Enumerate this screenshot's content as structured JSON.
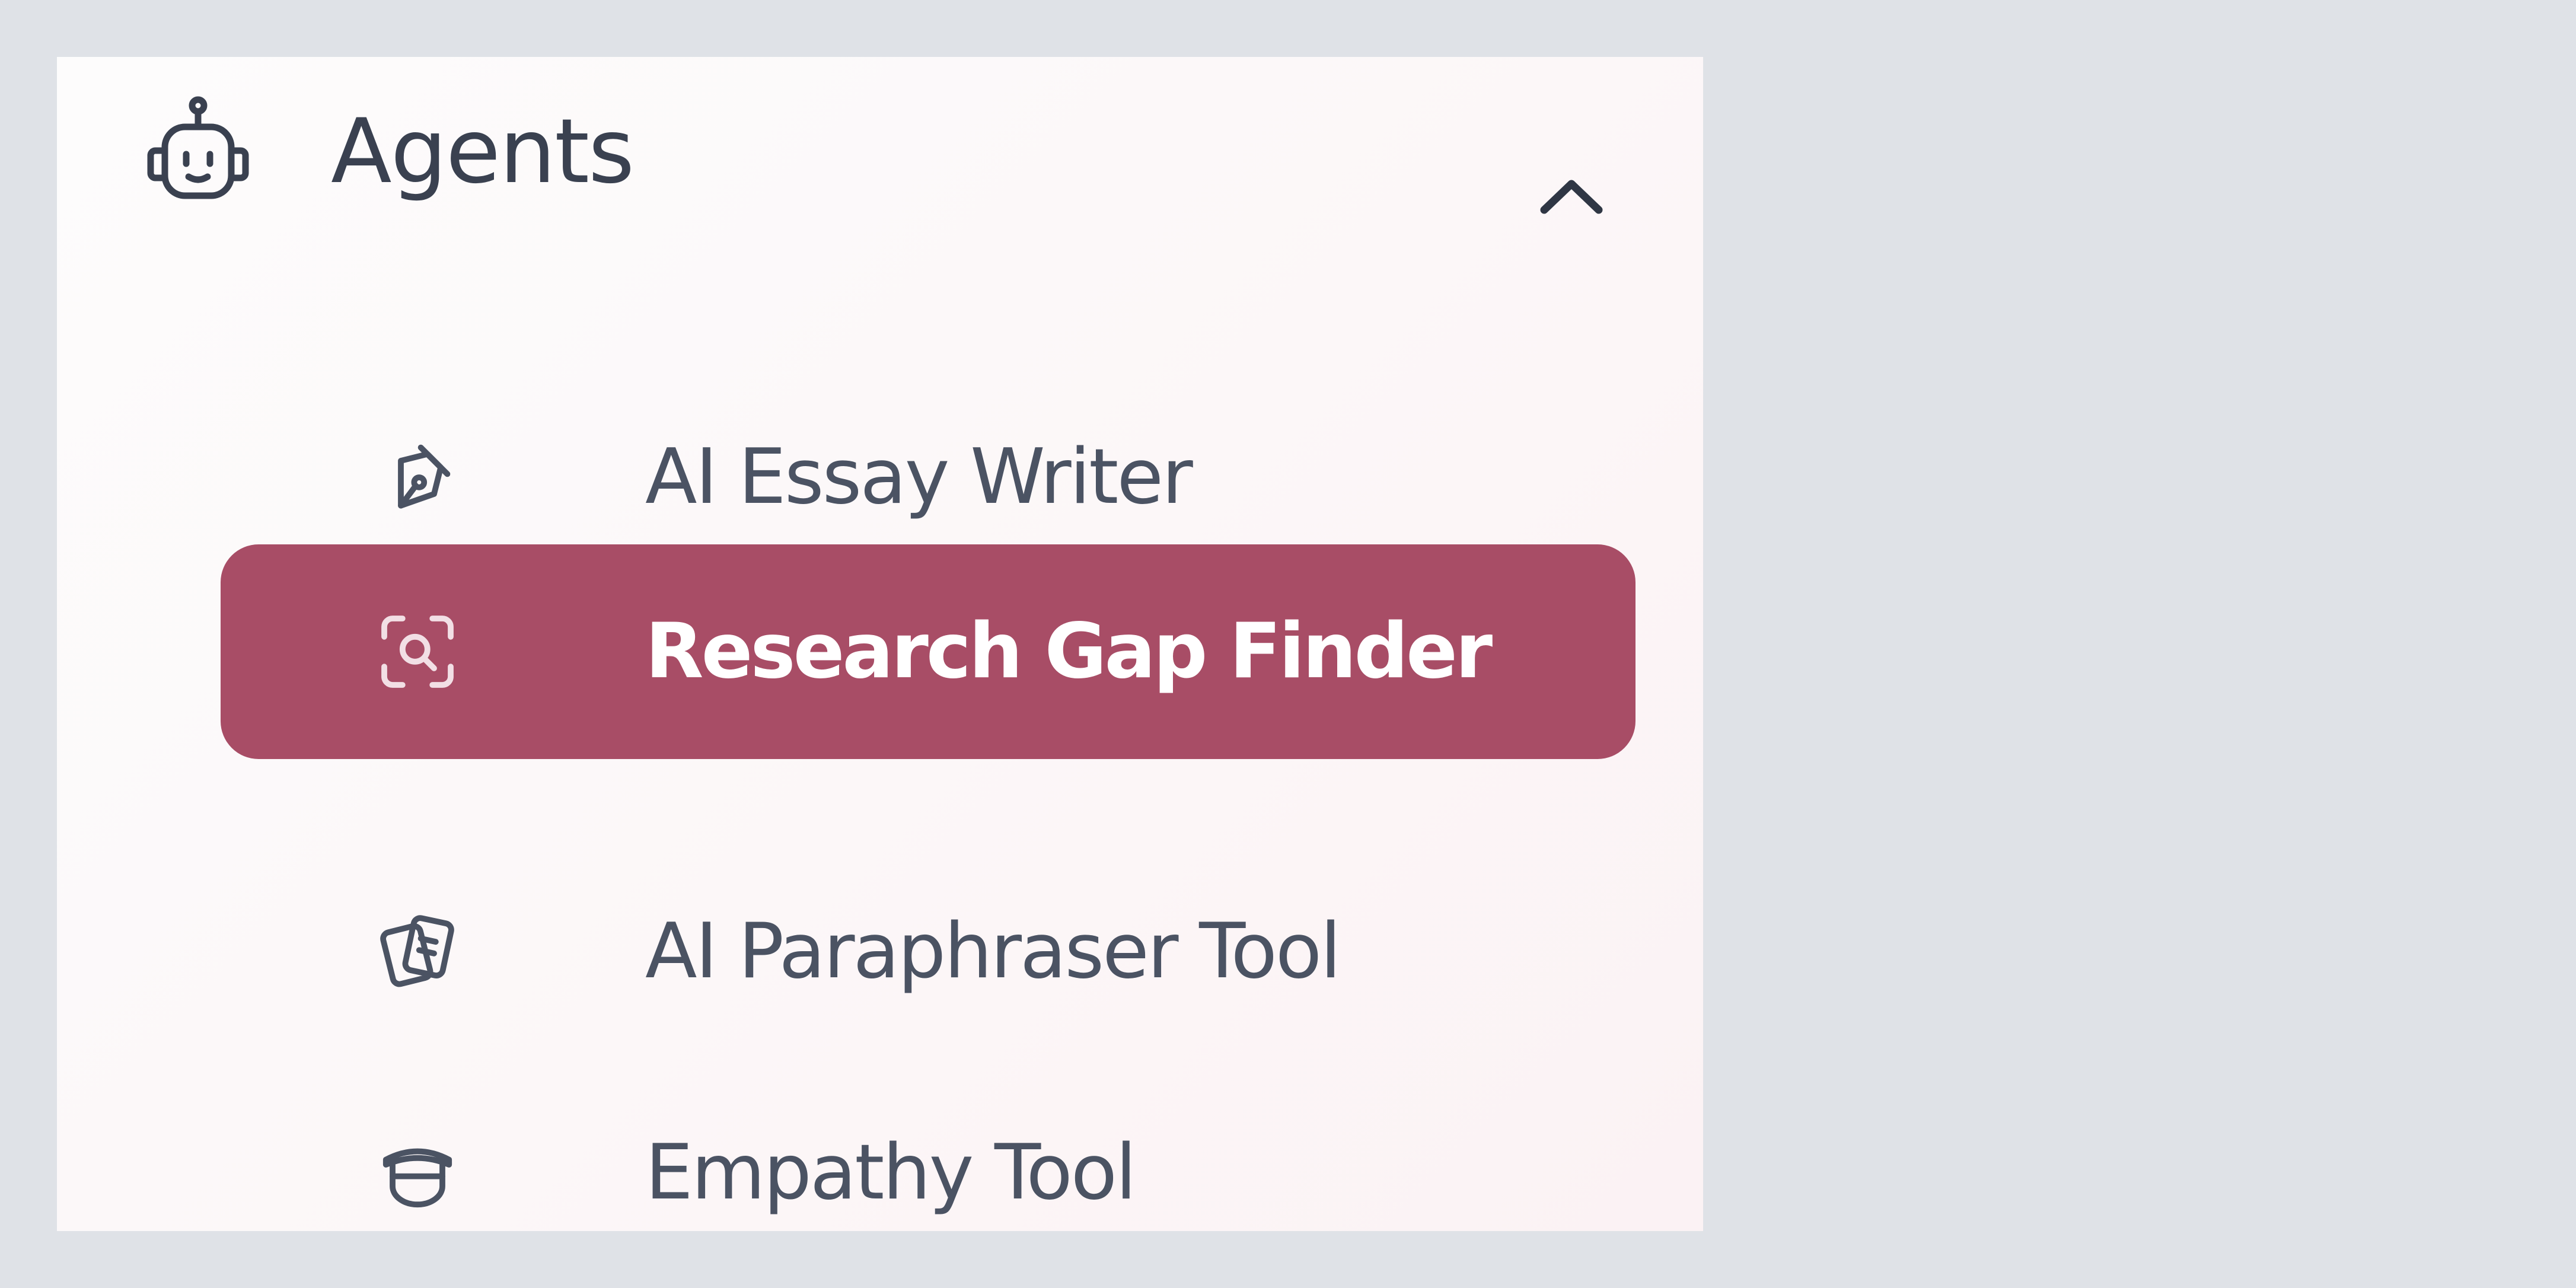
{
  "section": {
    "title": "Agents",
    "icon": "robot-icon",
    "toggle_icon": "chevron-up-icon",
    "expanded": true
  },
  "menu": {
    "items": [
      {
        "label": "AI Essay Writer",
        "icon": "pen-nib-icon",
        "active": false
      },
      {
        "label": "Research Gap Finder",
        "icon": "scan-search-icon",
        "active": true
      },
      {
        "label": "AI Paraphraser Tool",
        "icon": "cards-icon",
        "active": false
      },
      {
        "label": "Empathy Tool",
        "icon": "graduation-cap-icon",
        "active": false
      }
    ]
  },
  "colors": {
    "page_background": "#dfe2e7",
    "panel_background": "#fcf7f8",
    "active_item_background": "#a84d66",
    "active_item_text": "#ffffff",
    "text": "#4b5363"
  }
}
